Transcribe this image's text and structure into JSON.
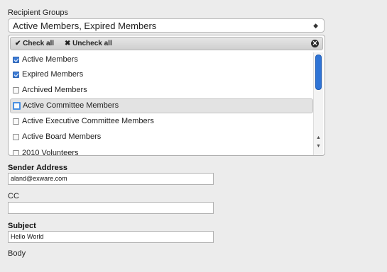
{
  "recipient_groups": {
    "label": "Recipient Groups",
    "selected_text": "Active Members, Expired Members",
    "check_all": "✔ Check all",
    "uncheck_all": "✖ Uncheck all",
    "options": [
      {
        "label": "Active Members",
        "checked": true
      },
      {
        "label": "Expired Members",
        "checked": true
      },
      {
        "label": "Archived Members",
        "checked": false
      },
      {
        "label": "Active Committee Members",
        "checked": false,
        "highlighted": true
      },
      {
        "label": "Active Executive Committee Members",
        "checked": false
      },
      {
        "label": "Active Board Members",
        "checked": false
      },
      {
        "label": "2010 Volunteers",
        "checked": false
      }
    ]
  },
  "sender_address": {
    "label": "Sender Address",
    "value": "aland@exware.com"
  },
  "cc": {
    "label": "CC",
    "value": ""
  },
  "subject": {
    "label": "Subject",
    "value": "Hello World"
  },
  "body": {
    "label": "Body"
  },
  "colors": {
    "accent": "#3d7cd6",
    "background": "#ececec"
  }
}
